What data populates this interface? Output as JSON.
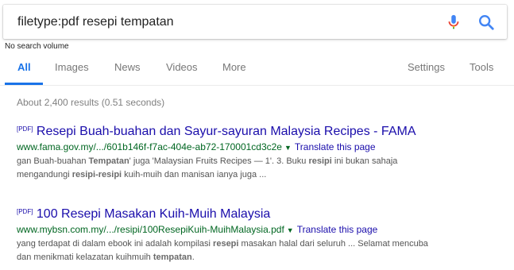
{
  "search": {
    "query": "filetype:pdf resepi tempatan"
  },
  "search_volume": "No search volume",
  "nav": {
    "tabs": [
      "All",
      "Images",
      "News",
      "Videos",
      "More"
    ],
    "settings": "Settings",
    "tools": "Tools"
  },
  "stats": "About 2,400 results (0.51 seconds)",
  "colors": {
    "link": "#1a0dab",
    "url": "#006621",
    "active_tab": "#1a73e8"
  },
  "results": [
    {
      "tag": "[PDF]",
      "title": "Resepi Buah-buahan dan Sayur-sayuran Malaysia Recipes - FAMA",
      "url": "www.fama.gov.my/.../601b146f-f7ac-404e-ab72-170001cd3c2e",
      "translate": "Translate this page",
      "snippet": [
        [
          "gan Buah-buahan ",
          false
        ],
        [
          "Tempatan",
          true
        ],
        [
          "' juga 'Malaysian Fruits Recipes — 1'. 3. Buku ",
          false
        ],
        [
          "resipi",
          true
        ],
        [
          " ini bukan sahaja",
          false
        ],
        [
          "\n",
          false
        ],
        [
          "mengandungi ",
          false
        ],
        [
          "resipi-resipi",
          true
        ],
        [
          " kuih-muih dan manisan ianya juga ...",
          false
        ]
      ]
    },
    {
      "tag": "[PDF]",
      "title": "100 Resepi Masakan Kuih-Muih Malaysia",
      "url": "www.mybsn.com.my/.../resipi/100ResepiKuih-MuihMalaysia.pdf",
      "translate": "Translate this page",
      "snippet": [
        [
          "yang terdapat di dalam ebook ini adalah kompilasi ",
          false
        ],
        [
          "resepi",
          true
        ],
        [
          " masakan halal dari seluruh ... Selamat mencuba",
          false
        ],
        [
          "\n",
          false
        ],
        [
          "dan menikmati kelazatan kuihmuih ",
          false
        ],
        [
          "tempatan",
          true
        ],
        [
          ".",
          false
        ]
      ]
    }
  ]
}
